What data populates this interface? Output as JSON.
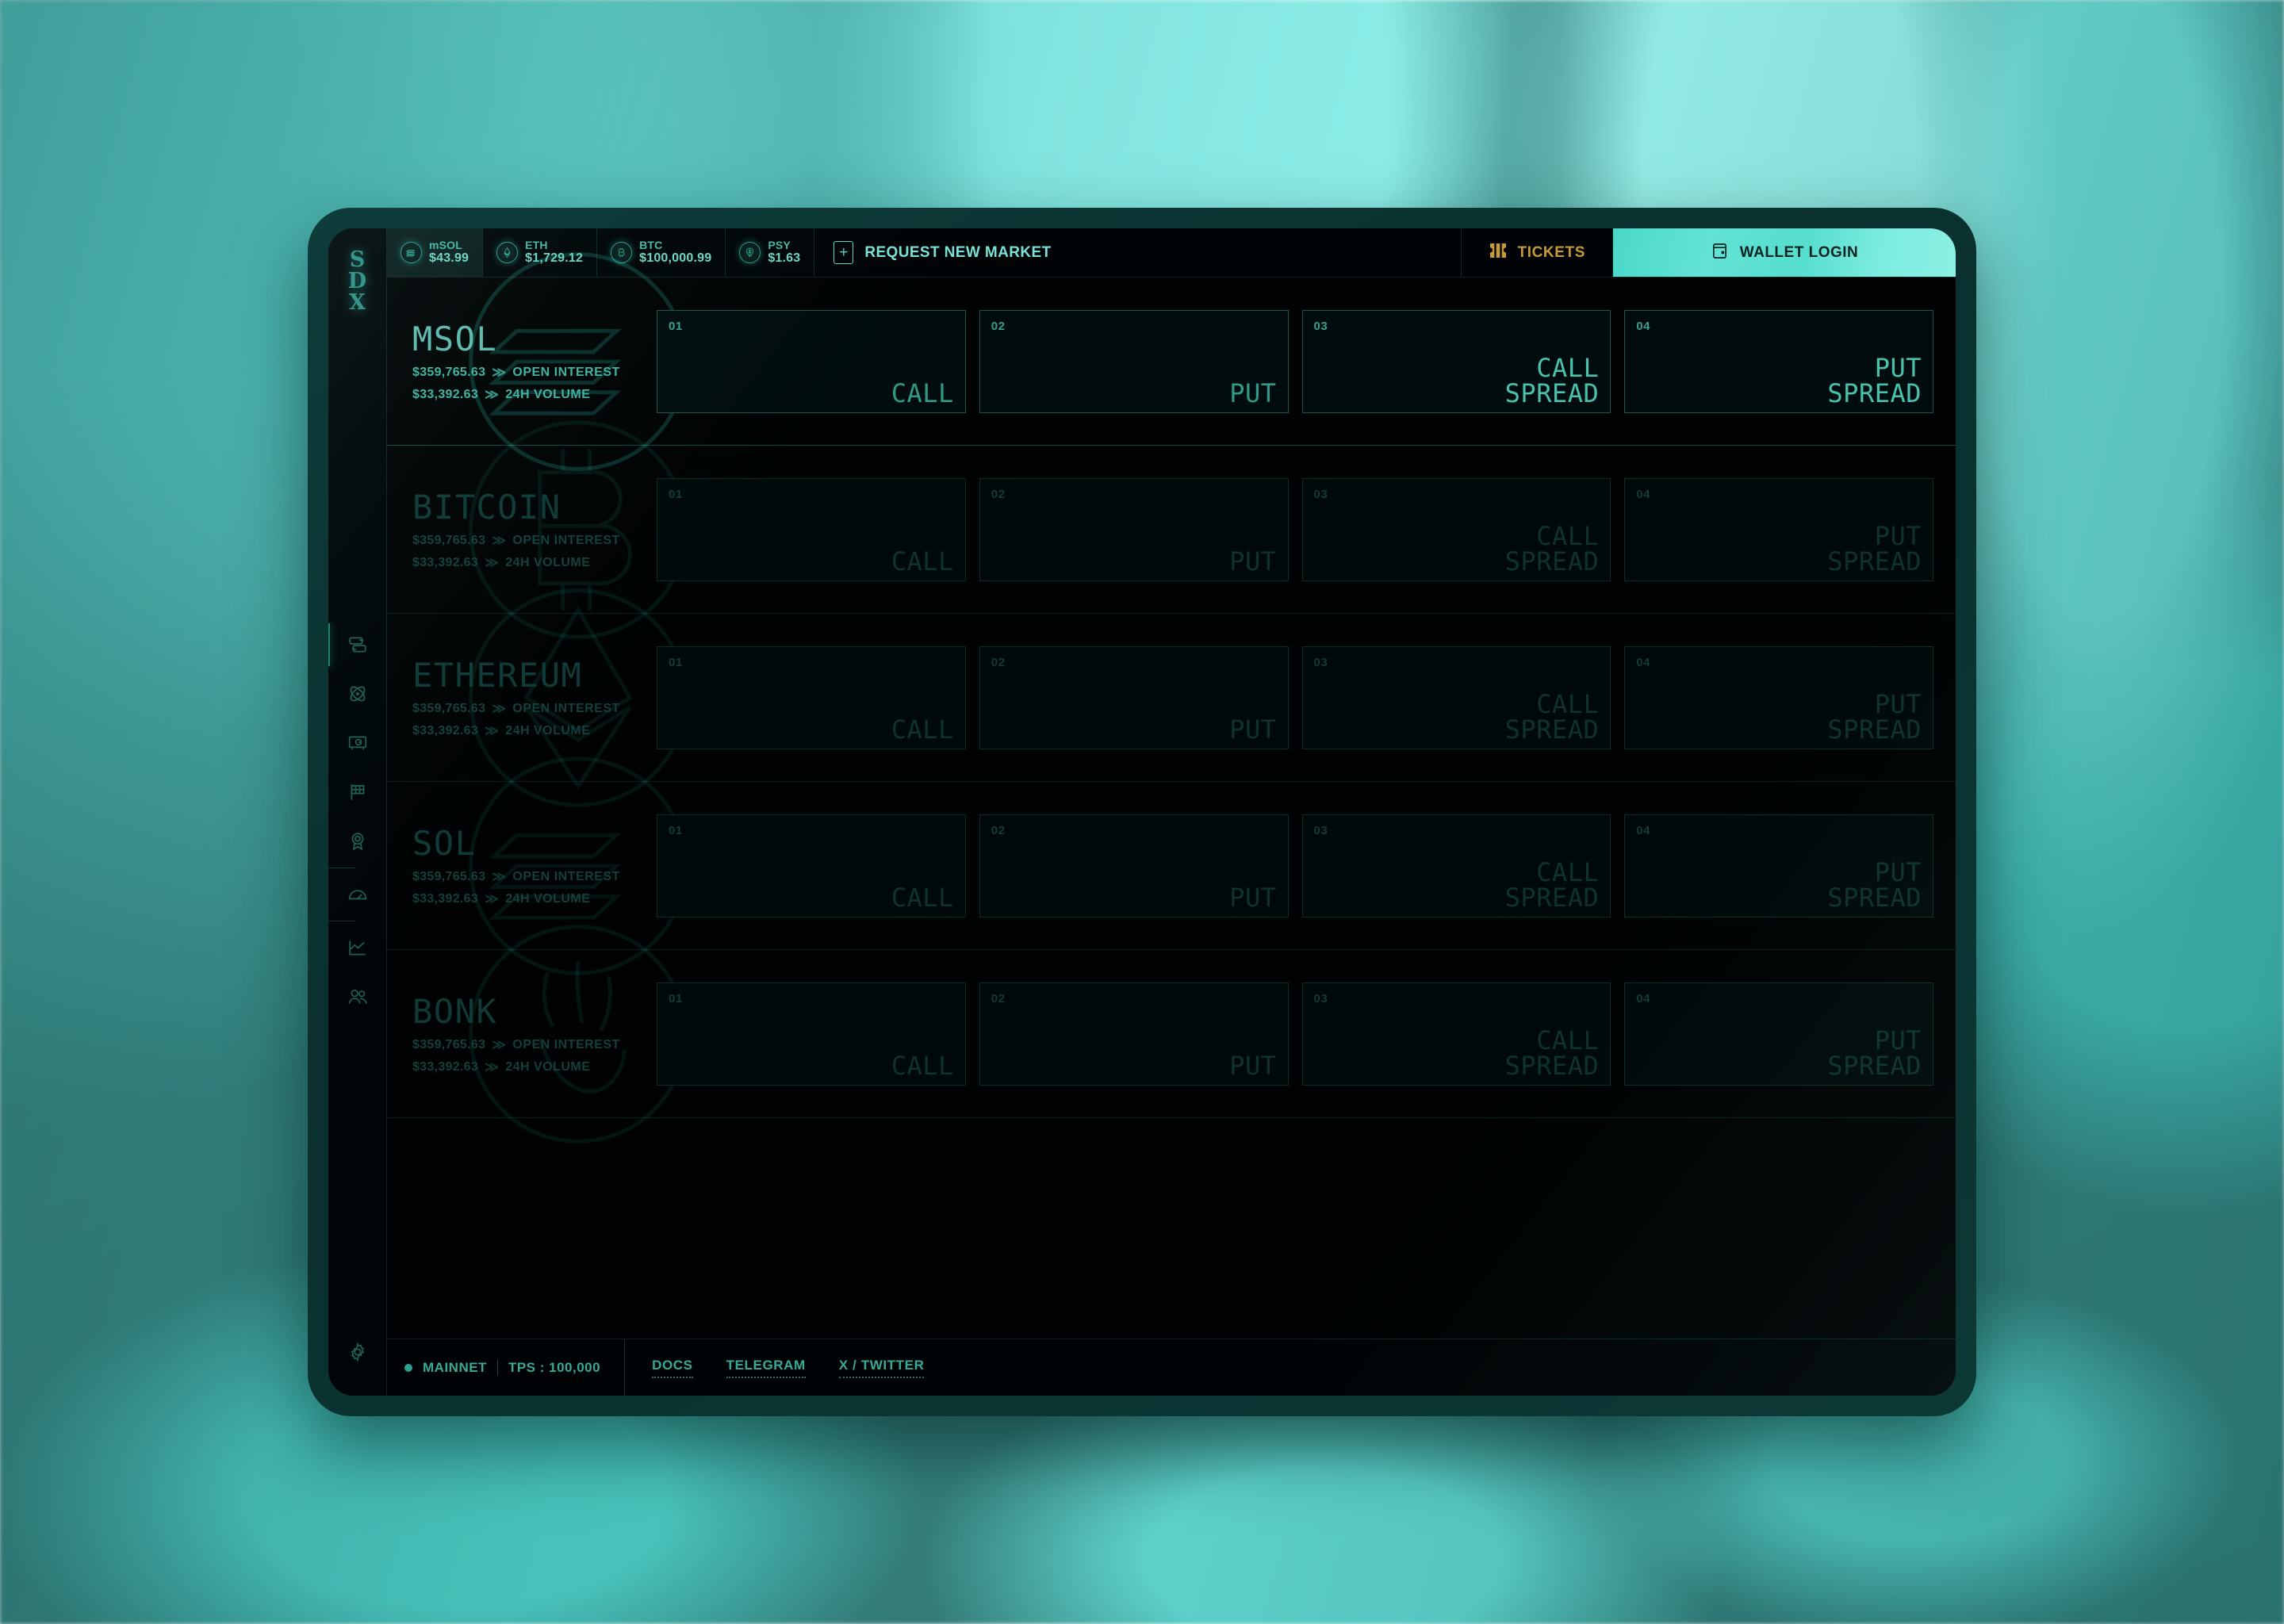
{
  "brand": {
    "logo_lines": [
      "S",
      "D",
      "X"
    ]
  },
  "topbar": {
    "tickers": [
      {
        "symbol": "mSOL",
        "price": "$43.99",
        "icon": "msol-coin-icon",
        "selected": true
      },
      {
        "symbol": "ETH",
        "price": "$1,729.12",
        "icon": "eth-coin-icon",
        "selected": false
      },
      {
        "symbol": "BTC",
        "price": "$100,000.99",
        "icon": "btc-coin-icon",
        "selected": false
      },
      {
        "symbol": "PSY",
        "price": "$1.63",
        "icon": "psy-coin-icon",
        "selected": false
      }
    ],
    "request_label": "REQUEST NEW MARKET",
    "request_icon": "plus-square-icon",
    "tickets_label": "TICKETS",
    "tickets_icon": "ticket-icon",
    "tickets_color": "#c89a3c",
    "wallet_label": "WALLET LOGIN",
    "wallet_icon": "wallet-icon",
    "wallet_accent": "#63e3d4"
  },
  "sidebar": {
    "items": [
      {
        "name": "sidebar-item-swap",
        "icon": "swap-icon",
        "active": true
      },
      {
        "name": "sidebar-item-atom",
        "icon": "atom-icon",
        "active": false
      },
      {
        "name": "sidebar-item-vault",
        "icon": "vault-icon",
        "active": false
      },
      {
        "name": "sidebar-item-race",
        "icon": "checkered-flag-icon",
        "active": false
      },
      {
        "name": "sidebar-item-rewards",
        "icon": "award-ribbon-icon",
        "active": false
      },
      {
        "name": "sidebar-item-gauge",
        "icon": "gauge-icon",
        "active": false
      },
      {
        "name": "sidebar-item-analytics",
        "icon": "line-chart-icon",
        "active": false
      },
      {
        "name": "sidebar-item-community",
        "icon": "people-icon",
        "active": false
      }
    ],
    "settings_icon": "gear-icon"
  },
  "markets": {
    "stat_labels": {
      "open_interest": "OPEN INTEREST",
      "volume": "24H VOLUME"
    },
    "chevron": "≫",
    "rows": [
      {
        "name": "MSOL",
        "active": true,
        "watermark": "solana-logo-watermark",
        "open_interest": "$359,765.63",
        "volume": "$33,392.63",
        "cards": [
          {
            "index": "01",
            "label": "CALL",
            "bright": false
          },
          {
            "index": "02",
            "label": "PUT",
            "bright": false
          },
          {
            "index": "03",
            "label": "CALL\nSPREAD",
            "bright": true
          },
          {
            "index": "04",
            "label": "PUT\nSPREAD",
            "bright": true
          }
        ]
      },
      {
        "name": "BITCOIN",
        "active": false,
        "watermark": "bitcoin-logo-watermark",
        "open_interest": "$359,765.63",
        "volume": "$33,392.63",
        "cards": [
          {
            "index": "01",
            "label": "CALL",
            "bright": false
          },
          {
            "index": "02",
            "label": "PUT",
            "bright": false
          },
          {
            "index": "03",
            "label": "CALL\nSPREAD",
            "bright": false
          },
          {
            "index": "04",
            "label": "PUT\nSPREAD",
            "bright": false
          }
        ]
      },
      {
        "name": "ETHEREUM",
        "active": false,
        "watermark": "ethereum-logo-watermark",
        "open_interest": "$359,765.63",
        "volume": "$33,392.63",
        "cards": [
          {
            "index": "01",
            "label": "CALL",
            "bright": false
          },
          {
            "index": "02",
            "label": "PUT",
            "bright": false
          },
          {
            "index": "03",
            "label": "CALL\nSPREAD",
            "bright": false
          },
          {
            "index": "04",
            "label": "PUT\nSPREAD",
            "bright": false
          }
        ]
      },
      {
        "name": "SOL",
        "active": false,
        "watermark": "solana-logo-watermark",
        "open_interest": "$359,765.63",
        "volume": "$33,392.63",
        "cards": [
          {
            "index": "01",
            "label": "CALL",
            "bright": false
          },
          {
            "index": "02",
            "label": "PUT",
            "bright": false
          },
          {
            "index": "03",
            "label": "CALL\nSPREAD",
            "bright": false
          },
          {
            "index": "04",
            "label": "PUT\nSPREAD",
            "bright": false
          }
        ]
      },
      {
        "name": "BONK",
        "active": false,
        "watermark": "bonk-logo-watermark",
        "open_interest": "$359,765.63",
        "volume": "$33,392.63",
        "cards": [
          {
            "index": "01",
            "label": "CALL",
            "bright": false
          },
          {
            "index": "02",
            "label": "PUT",
            "bright": false
          },
          {
            "index": "03",
            "label": "CALL\nSPREAD",
            "bright": false
          },
          {
            "index": "04",
            "label": "PUT\nSPREAD",
            "bright": false
          }
        ]
      }
    ]
  },
  "footer": {
    "network": "MAINNET",
    "tps": "TPS : 100,000",
    "status_color": "#2fa28f",
    "links": [
      {
        "label": "DOCS"
      },
      {
        "label": "TELEGRAM"
      },
      {
        "label": "X / TWITTER"
      }
    ]
  }
}
